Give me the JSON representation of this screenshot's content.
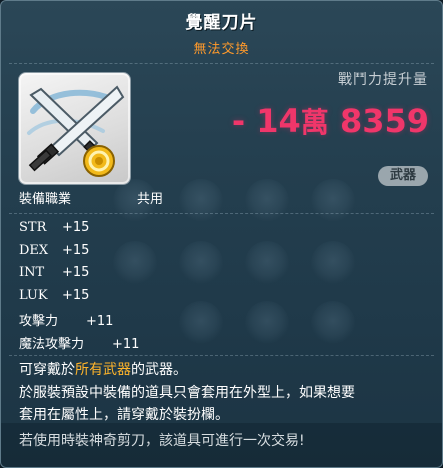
{
  "item": {
    "name": "覺醒刀片",
    "trade_status": "無法交換",
    "icon": "crossed-swords-coin-icon"
  },
  "combat_power": {
    "label": "戰鬥力提升量",
    "sign": "-",
    "num1": "14",
    "unit": "萬",
    "num2": "8359"
  },
  "category_badge": "武器",
  "requirements": {
    "job_label": "裝備職業",
    "job_value": "共用"
  },
  "stats": [
    {
      "name": "STR",
      "value": "+15"
    },
    {
      "name": "DEX",
      "value": "+15"
    },
    {
      "name": "INT",
      "value": "+15"
    },
    {
      "name": "LUK",
      "value": "+15"
    }
  ],
  "attack": {
    "name": "攻擊力",
    "value": "+11"
  },
  "magic_attack": {
    "name": "魔法攻擊力",
    "value": "+11"
  },
  "description": {
    "line1_pre": "可穿戴於",
    "line1_hl": "所有武器",
    "line1_post": "的武器。",
    "line2": "於服裝預設中裝備的道具只會套用在外型上，如果想要",
    "line3": "套用在屬性上，請穿戴於裝扮欄。"
  },
  "footer": "若使用時裝神奇剪刀，該道具可進行一次交易!",
  "colors": {
    "background": "#243f4f",
    "title": "#ffffff",
    "trade_status": "#ff9a2b",
    "combat_power": "#f0366a",
    "highlight": "#ffb52b"
  }
}
